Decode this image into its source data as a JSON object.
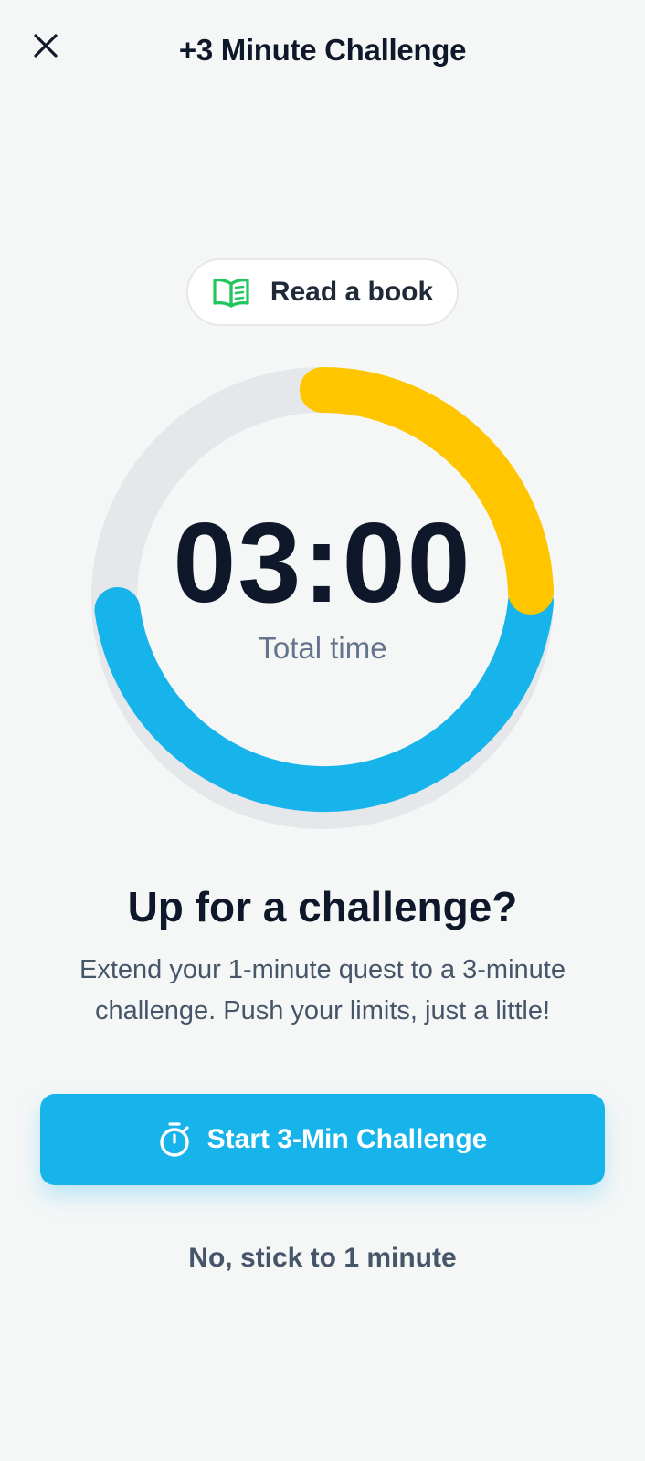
{
  "header": {
    "title": "+3 Minute Challenge",
    "close_icon": "close-icon"
  },
  "task": {
    "icon": "book-icon",
    "label": "Read a book",
    "icon_color": "#22c55e"
  },
  "timer": {
    "value": "03:00",
    "caption": "Total time",
    "total_minutes": 3,
    "segments": [
      {
        "name": "extra",
        "color": "#ffc600"
      },
      {
        "name": "base",
        "color": "#16b4ea"
      }
    ],
    "track_color": "#e5e7eb"
  },
  "prompt": {
    "heading": "Up for a challenge?",
    "description": "Extend your 1-minute quest to a 3-minute challenge. Push your limits, just a little!"
  },
  "actions": {
    "primary_label": "Start 3-Min Challenge",
    "primary_icon": "stopwatch-icon",
    "primary_color": "#16b4ea",
    "secondary_label": "No, stick to 1 minute"
  }
}
